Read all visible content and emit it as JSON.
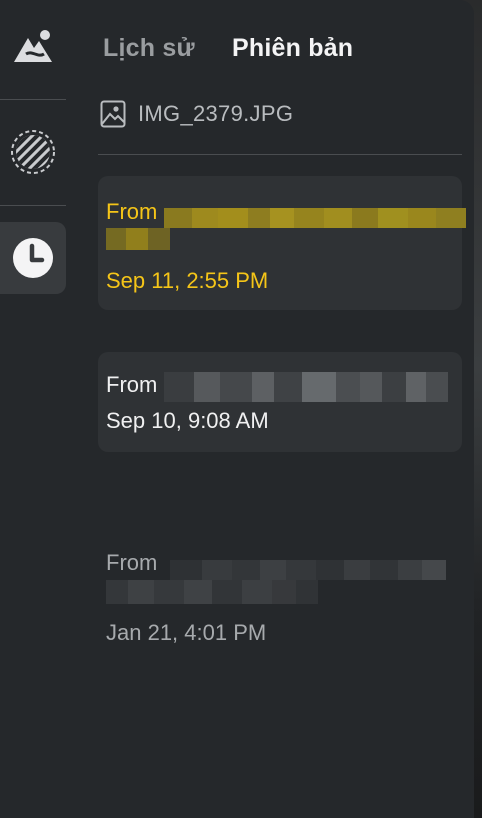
{
  "tabs": {
    "history": "Lịch sử",
    "versions": "Phiên bản"
  },
  "file": {
    "name": "IMG_2379.JPG",
    "icon": "image-icon"
  },
  "rail": {
    "icons": [
      "adjust-icon",
      "filter-icon",
      "history-clock-icon"
    ],
    "active": "history-clock-icon"
  },
  "versions": [
    {
      "from_label": "From",
      "timestamp": "Sep 11, 2:55 PM",
      "state": "selected",
      "color": "#f5c518"
    },
    {
      "from_label": "From",
      "timestamp": "Sep 10, 9:08 AM",
      "state": "normal",
      "color": "#f0f0f1"
    },
    {
      "from_label": "From",
      "timestamp": "Jan 21, 4:01 PM",
      "state": "dimmed",
      "color": "#a7aaad"
    }
  ],
  "colors": {
    "panel": "#25282b",
    "accent": "#f5c518",
    "active_rail": "#383b3e"
  }
}
